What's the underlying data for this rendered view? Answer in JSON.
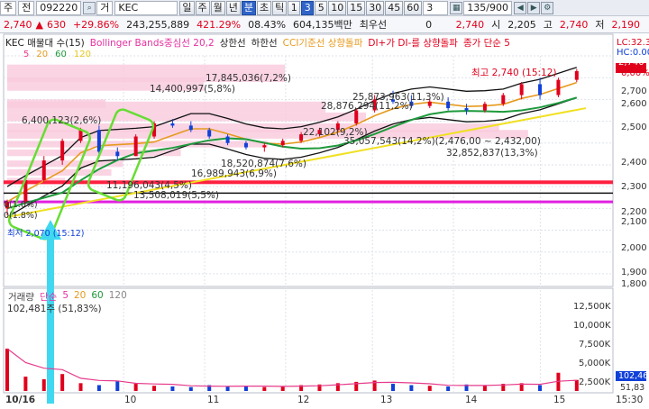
{
  "toolbar1": {
    "market": "주",
    "period": "전",
    "code": "092220",
    "type": "거",
    "name": "KEC",
    "tabs": [
      "일",
      "주",
      "월",
      "년",
      "분",
      "초",
      "틱",
      "1",
      "3",
      "5",
      "10",
      "15",
      "30",
      "45",
      "60"
    ],
    "active_tabs": [
      "분",
      "3"
    ],
    "price": "2,740",
    "change": "630",
    "change_pct": "+29.86%",
    "volume": "243,255,889",
    "volume_pct": "421.29%",
    "turnover_pct": "08.43%",
    "amount": "604,135백만",
    "priority_label": "최우선",
    "priority_value": "0",
    "quote_price": "2,740",
    "open_label": "시",
    "open": "2,205",
    "high_label": "고",
    "high": "2,740",
    "low_label": "저",
    "low": "2,190",
    "unit_select": "3",
    "count_value": "135/900",
    "right_values": [
      "2,740",
      "2,190"
    ]
  },
  "legend": {
    "title": "KEC 매물대 수(15)",
    "bollinger": "Bollinger Bands중심선 20,2",
    "upper": "상한선",
    "lower": "하한선",
    "cci": "CCI기준선 상향돌파",
    "di": "DI+가 DI-를 상향돌파",
    "close": "종가 단순 5",
    "ma_row": [
      "5",
      "20",
      "60",
      "120"
    ],
    "ma_colors": [
      "#e63c8c",
      "#e69a1e",
      "#1e9a3c",
      "#e6c81e"
    ],
    "lc": "LC:32.3",
    "hc": "HC:0.00"
  },
  "volume_profile": [
    "17,845,036(7,2%)",
    "14,400,997(5,8%)",
    "6,400,123(2,6%)",
    "28,876,294(11,2%)",
    "25,873,963(11,3%)",
    "35,057,543(14,2%)(2,476,00 ~ 2,432,00)",
    "32,852,837(13,3%)",
    "18,520,874(7,6%)",
    "16,989,943(6,9%)",
    "11,196,043(4,5%)",
    "13,508,019(5,5%)",
    "22,102(9,2%)"
  ],
  "annotations": {
    "high": "최고 2,740 (15:12)",
    "low": "최저 2,070 (15:12)",
    "left_marks": [
      "0(1.0%)",
      "0(1.8%)"
    ]
  },
  "price_axis": [
    "2,740",
    "0,00%",
    "2,700",
    "2,600",
    "2,500",
    "2,400",
    "2,300",
    "2,200",
    "2,100",
    "2,000",
    "1,900",
    "1,800"
  ],
  "volume_panel": {
    "legend": [
      "거래량",
      "단순",
      "5",
      "20",
      "60",
      "120"
    ],
    "value": "102,481주 (51,83%)",
    "axis": [
      "12,500K",
      "10,000K",
      "7,500K",
      "5,000K",
      "2,500K"
    ],
    "current_label": "102,46",
    "pct_label": "51,83"
  },
  "time_axis": [
    "10/16",
    "10",
    "11",
    "12",
    "13",
    "14",
    "15",
    "15:30"
  ],
  "colors": {
    "up": "#e0001c",
    "down": "#1040d8",
    "profile": "#f9c9dc",
    "bb": "#111111",
    "ma20": "#e69a1e",
    "ma60": "#1e9a3c",
    "ma120": "#f0e020",
    "support_red": "#ff2040",
    "support_mag": "#e020e0",
    "box": "#66dd33",
    "arrow": "#40d8f0"
  },
  "chart_data": {
    "type": "candlestick",
    "time_labels": [
      "10/16",
      "10",
      "11",
      "12",
      "13",
      "14",
      "15"
    ],
    "price_range": [
      1750,
      2800
    ],
    "bars": [
      {
        "t": 0,
        "o": 2100,
        "h": 2140,
        "l": 2070,
        "c": 2130
      },
      {
        "t": 4,
        "o": 2130,
        "h": 2240,
        "l": 2120,
        "c": 2230
      },
      {
        "t": 8,
        "o": 2230,
        "h": 2340,
        "l": 2220,
        "c": 2320
      },
      {
        "t": 12,
        "o": 2320,
        "h": 2420,
        "l": 2300,
        "c": 2410
      },
      {
        "t": 16,
        "o": 2410,
        "h": 2470,
        "l": 2400,
        "c": 2460
      },
      {
        "t": 20,
        "o": 2460,
        "h": 2480,
        "l": 2340,
        "c": 2360
      },
      {
        "t": 24,
        "o": 2360,
        "h": 2380,
        "l": 2320,
        "c": 2340
      },
      {
        "t": 28,
        "o": 2340,
        "h": 2440,
        "l": 2340,
        "c": 2430
      },
      {
        "t": 32,
        "o": 2430,
        "h": 2500,
        "l": 2420,
        "c": 2490
      },
      {
        "t": 36,
        "o": 2490,
        "h": 2510,
        "l": 2470,
        "c": 2480
      },
      {
        "t": 40,
        "o": 2480,
        "h": 2500,
        "l": 2450,
        "c": 2460
      },
      {
        "t": 44,
        "o": 2460,
        "h": 2470,
        "l": 2420,
        "c": 2430
      },
      {
        "t": 48,
        "o": 2430,
        "h": 2440,
        "l": 2390,
        "c": 2400
      },
      {
        "t": 52,
        "o": 2400,
        "h": 2410,
        "l": 2370,
        "c": 2380
      },
      {
        "t": 56,
        "o": 2380,
        "h": 2400,
        "l": 2360,
        "c": 2390
      },
      {
        "t": 60,
        "o": 2390,
        "h": 2420,
        "l": 2380,
        "c": 2410
      },
      {
        "t": 64,
        "o": 2410,
        "h": 2450,
        "l": 2400,
        "c": 2440
      },
      {
        "t": 68,
        "o": 2440,
        "h": 2470,
        "l": 2430,
        "c": 2460
      },
      {
        "t": 72,
        "o": 2460,
        "h": 2500,
        "l": 2450,
        "c": 2490
      },
      {
        "t": 76,
        "o": 2490,
        "h": 2560,
        "l": 2480,
        "c": 2550
      },
      {
        "t": 80,
        "o": 2550,
        "h": 2620,
        "l": 2540,
        "c": 2600
      },
      {
        "t": 84,
        "o": 2600,
        "h": 2640,
        "l": 2580,
        "c": 2590
      },
      {
        "t": 88,
        "o": 2590,
        "h": 2620,
        "l": 2560,
        "c": 2570
      },
      {
        "t": 92,
        "o": 2570,
        "h": 2600,
        "l": 2560,
        "c": 2590
      },
      {
        "t": 96,
        "o": 2590,
        "h": 2610,
        "l": 2550,
        "c": 2560
      },
      {
        "t": 100,
        "o": 2560,
        "h": 2580,
        "l": 2530,
        "c": 2550
      },
      {
        "t": 104,
        "o": 2550,
        "h": 2590,
        "l": 2540,
        "c": 2580
      },
      {
        "t": 108,
        "o": 2580,
        "h": 2630,
        "l": 2570,
        "c": 2620
      },
      {
        "t": 112,
        "o": 2620,
        "h": 2680,
        "l": 2600,
        "c": 2670
      },
      {
        "t": 116,
        "o": 2670,
        "h": 2700,
        "l": 2600,
        "c": 2620
      },
      {
        "t": 120,
        "o": 2620,
        "h": 2700,
        "l": 2610,
        "c": 2690
      },
      {
        "t": 124,
        "o": 2690,
        "h": 2740,
        "l": 2680,
        "c": 2730
      }
    ],
    "volumes": [
      6500,
      2200,
      1800,
      2600,
      1200,
      900,
      1500,
      1100,
      800,
      700,
      600,
      900,
      700,
      800,
      600,
      700,
      900,
      1000,
      1200,
      1400,
      1600,
      1100,
      900,
      800,
      700,
      1000,
      900,
      1100,
      1200,
      900,
      2800,
      1700
    ],
    "support_lines": [
      2220,
      2170,
      2130
    ]
  }
}
